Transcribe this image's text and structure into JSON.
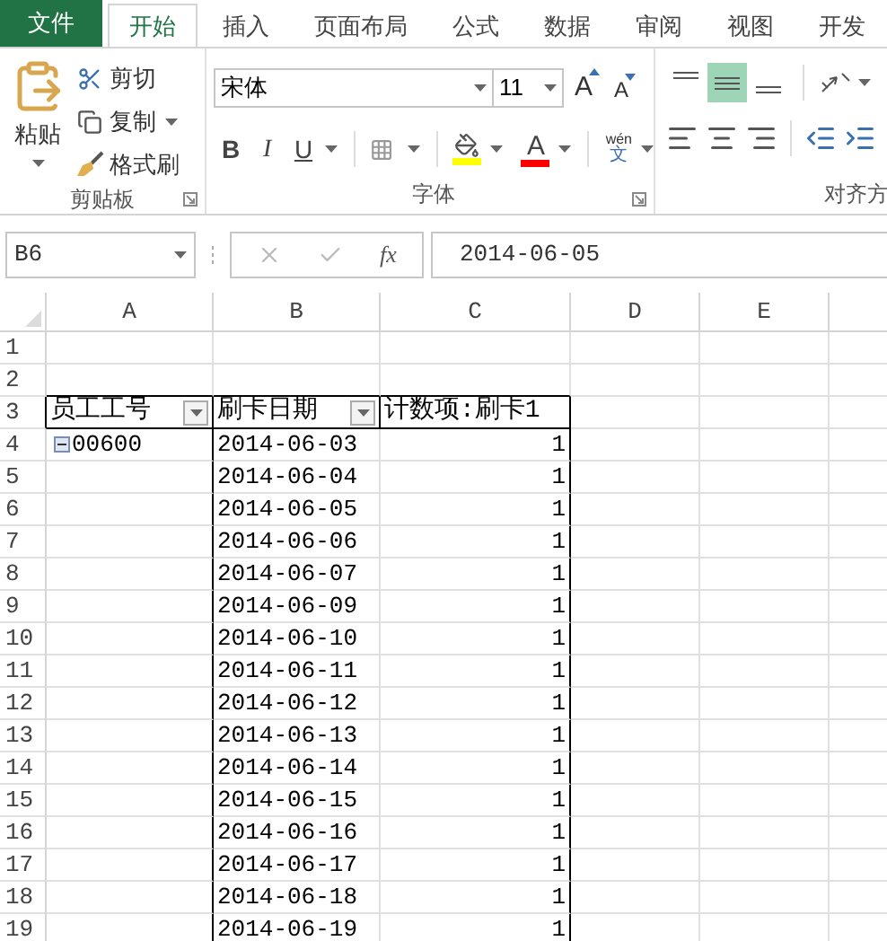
{
  "tabs": [
    {
      "label": "文件",
      "kind": "file",
      "selected": false
    },
    {
      "label": "开始",
      "kind": "tab",
      "selected": true
    },
    {
      "label": "插入",
      "kind": "tab",
      "selected": false
    },
    {
      "label": "页面布局",
      "kind": "tab",
      "selected": false
    },
    {
      "label": "公式",
      "kind": "tab",
      "selected": false
    },
    {
      "label": "数据",
      "kind": "tab",
      "selected": false
    },
    {
      "label": "审阅",
      "kind": "tab",
      "selected": false
    },
    {
      "label": "视图",
      "kind": "tab",
      "selected": false
    },
    {
      "label": "开发",
      "kind": "tab",
      "selected": false
    }
  ],
  "clipboard": {
    "label": "剪贴板",
    "paste": "粘贴",
    "items": [
      {
        "label": "剪切",
        "kind": "cut",
        "menu": false
      },
      {
        "label": "复制",
        "kind": "copy",
        "menu": true
      },
      {
        "label": "格式刷",
        "kind": "painter",
        "menu": false
      }
    ]
  },
  "font": {
    "label": "字体",
    "name": "宋体",
    "size": "11",
    "grow": "A",
    "shrink": "A",
    "styles": [
      "B",
      "I",
      "U"
    ],
    "color_letter": "A",
    "phonetic": [
      "wén",
      "文"
    ]
  },
  "alignment": {
    "label": "对齐方",
    "vertical": [
      {
        "selected": false
      },
      {
        "selected": true
      },
      {
        "selected": false
      }
    ]
  },
  "formula_bar": {
    "name_box": "B6",
    "fx": "fx",
    "value": "2014-06-05"
  },
  "sheet": {
    "columns": [
      "A",
      "B",
      "C",
      "D",
      "E"
    ],
    "rows": [
      {
        "number": "1",
        "kind": "empty",
        "cells": []
      },
      {
        "number": "2",
        "kind": "empty",
        "cells": []
      },
      {
        "number": "3",
        "kind": "header",
        "cells": [
          "员工工号",
          "刷卡日期",
          "计数项:刷卡1"
        ]
      },
      {
        "number": "4",
        "kind": "data",
        "group": {
          "label": "00600",
          "expanded": true
        },
        "cells": [
          "2014-06-03",
          "1"
        ]
      },
      {
        "number": "5",
        "kind": "data",
        "cells": [
          "2014-06-04",
          "1"
        ]
      },
      {
        "number": "6",
        "kind": "data",
        "cells": [
          "2014-06-05",
          "1"
        ]
      },
      {
        "number": "7",
        "kind": "data",
        "cells": [
          "2014-06-06",
          "1"
        ]
      },
      {
        "number": "8",
        "kind": "data",
        "cells": [
          "2014-06-07",
          "1"
        ]
      },
      {
        "number": "9",
        "kind": "data",
        "cells": [
          "2014-06-09",
          "1"
        ]
      },
      {
        "number": "10",
        "kind": "data",
        "cells": [
          "2014-06-10",
          "1"
        ]
      },
      {
        "number": "11",
        "kind": "data",
        "cells": [
          "2014-06-11",
          "1"
        ]
      },
      {
        "number": "12",
        "kind": "data",
        "cells": [
          "2014-06-12",
          "1"
        ]
      },
      {
        "number": "13",
        "kind": "data",
        "cells": [
          "2014-06-13",
          "1"
        ]
      },
      {
        "number": "14",
        "kind": "data",
        "cells": [
          "2014-06-14",
          "1"
        ]
      },
      {
        "number": "15",
        "kind": "data",
        "cells": [
          "2014-06-15",
          "1"
        ]
      },
      {
        "number": "16",
        "kind": "data",
        "cells": [
          "2014-06-16",
          "1"
        ]
      },
      {
        "number": "17",
        "kind": "data",
        "cells": [
          "2014-06-17",
          "1"
        ]
      },
      {
        "number": "18",
        "kind": "data",
        "cells": [
          "2014-06-18",
          "1"
        ]
      },
      {
        "number": "19",
        "kind": "data",
        "cells": [
          "2014-06-19",
          "1"
        ]
      }
    ]
  }
}
